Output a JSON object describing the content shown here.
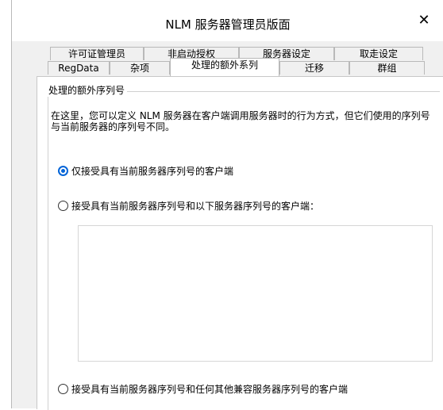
{
  "dialog": {
    "title": "NLM 服务器管理员版面",
    "close_glyph": "✕"
  },
  "tabs": {
    "row1": [
      "许可证管理员",
      "非启动授权",
      "服务器设定",
      "取走设定"
    ],
    "row2": [
      "RegData",
      "杂项",
      "处理的额外系列",
      "迁移",
      "群组"
    ],
    "active": "处理的额外系列"
  },
  "panel": {
    "group_label": "处理的额外序列号",
    "description": "在这里，您可以定义 NLM 服务器在客户端调用服务器时的行为方式，但它们使用的序列号与当前服务器的序列号不同。",
    "options": [
      {
        "label": "仅接受具有当前服务器序列号的客户端",
        "checked": true
      },
      {
        "label": "接受具有当前服务器序列号和以下服务器序列号的客户端：",
        "checked": false
      },
      {
        "label": "接受具有当前服务器序列号和任何其他兼容服务器序列号的客户端",
        "checked": false
      }
    ]
  },
  "colors": {
    "accent": "#0064d8",
    "dialog_bg": "#f0f0f0",
    "panel_bg": "#ffffff"
  }
}
